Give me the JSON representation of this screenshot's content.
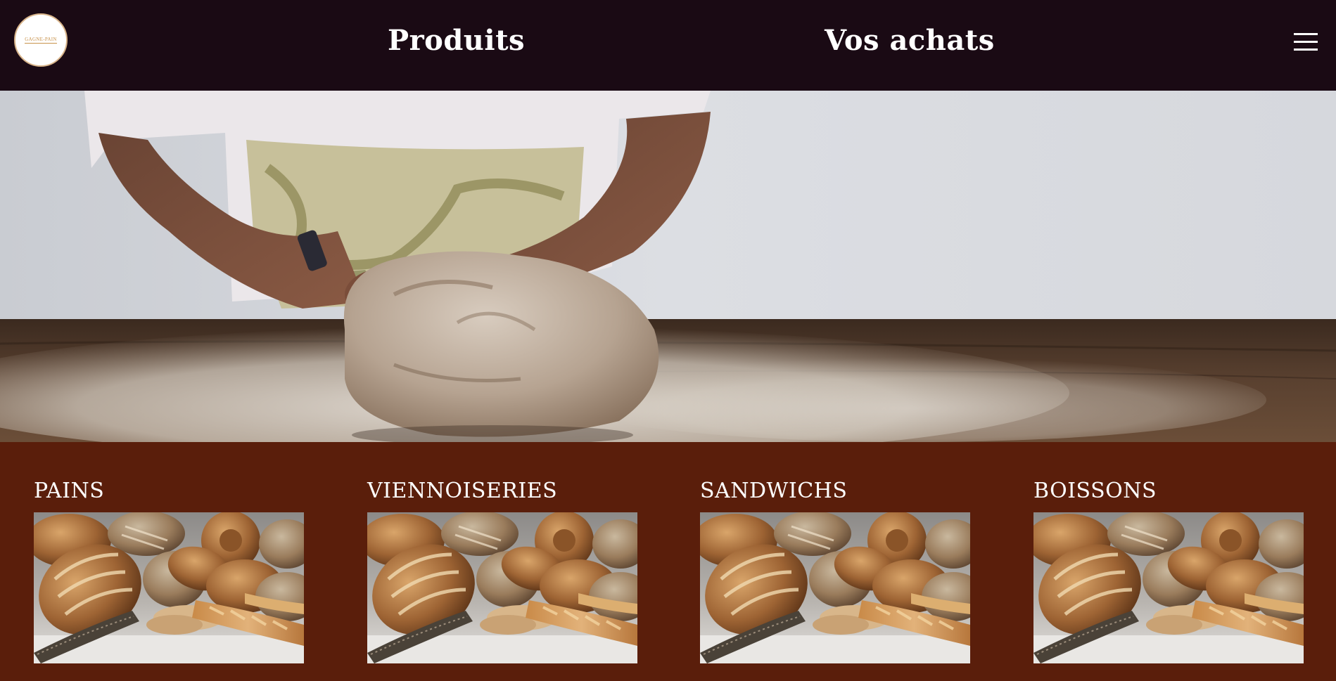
{
  "header": {
    "logo_text": "GAGNE-PAIN",
    "nav": [
      {
        "label": "Produits"
      },
      {
        "label": "Vos achats"
      }
    ],
    "menu_icon": "hamburger-menu-icon"
  },
  "hero": {
    "image": "baker-kneading-dough-photo"
  },
  "categories": [
    {
      "label": "PAINS",
      "image": "assorted-breads-photo"
    },
    {
      "label": "VIENNOISERIES",
      "image": "assorted-breads-photo"
    },
    {
      "label": "SANDWICHS",
      "image": "assorted-breads-photo"
    },
    {
      "label": "BOISSONS",
      "image": "assorted-breads-photo"
    }
  ],
  "colors": {
    "header_bg": "#1a0a14",
    "section_bg": "#5a1e0b",
    "text": "#ffffff",
    "logo_accent": "#c8924a"
  }
}
